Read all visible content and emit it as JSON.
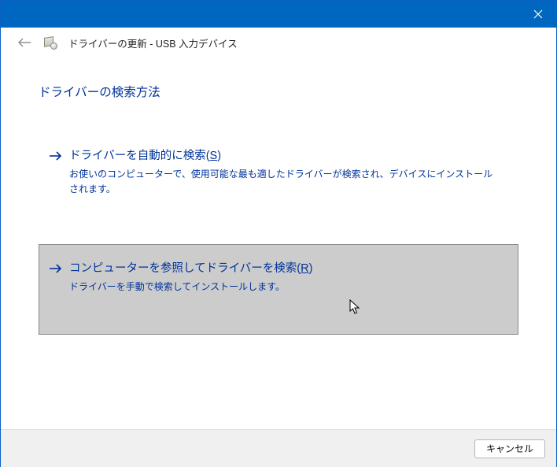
{
  "titlebar": {
    "close_label": "Close"
  },
  "header": {
    "title": "ドライバーの更新 - USB 入力デバイス"
  },
  "content": {
    "heading": "ドライバーの検索方法",
    "options": [
      {
        "title_pre": "ドライバーを自動的に検索(",
        "accel": "S",
        "title_post": ")",
        "desc": "お使いのコンピューターで、使用可能な最も適したドライバーが検索され、デバイスにインストールされます。",
        "selected": false
      },
      {
        "title_pre": "コンピューターを参照してドライバーを検索(",
        "accel": "R",
        "title_post": ")",
        "desc": "ドライバーを手動で検索してインストールします。",
        "selected": true
      }
    ]
  },
  "footer": {
    "cancel": "キャンセル"
  },
  "colors": {
    "accent": "#0067c0",
    "heading": "#003399"
  }
}
